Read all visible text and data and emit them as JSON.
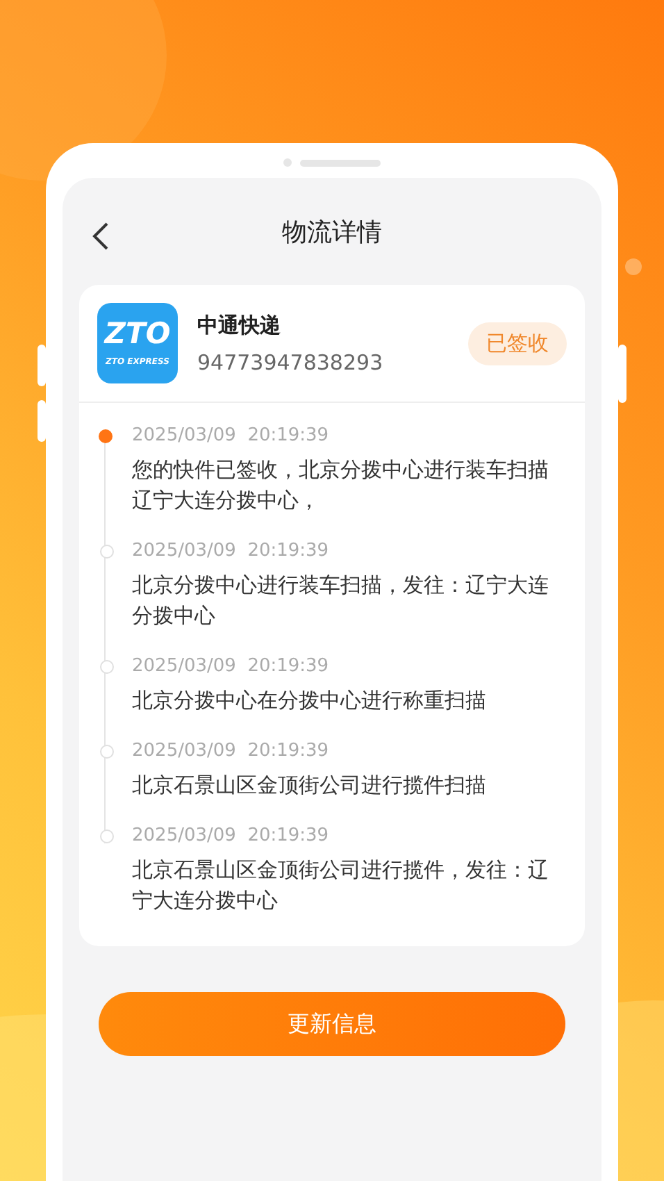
{
  "header": {
    "title": "物流详情"
  },
  "courier": {
    "logo_text": "ZTO",
    "logo_subtext": "ZTO EXPRESS",
    "name": "中通快递",
    "tracking_number": "94773947838293",
    "status": "已签收"
  },
  "timeline": [
    {
      "time": "2025/03/09  20:19:39",
      "text": "您的快件已签收，北京分拨中心进行装车扫描辽宁大连分拨中心，",
      "current": true
    },
    {
      "time": "2025/03/09  20:19:39",
      "text": "北京分拨中心进行装车扫描，发往：辽宁大连分拨中心",
      "current": false
    },
    {
      "time": "2025/03/09  20:19:39",
      "text": "北京分拨中心在分拨中心进行称重扫描",
      "current": false
    },
    {
      "time": "2025/03/09  20:19:39",
      "text": "北京石景山区金顶街公司进行揽件扫描",
      "current": false
    },
    {
      "time": "2025/03/09  20:19:39",
      "text": "北京石景山区金顶街公司进行揽件，发往：辽宁大连分拨中心",
      "current": false
    }
  ],
  "button": {
    "label": "更新信息"
  }
}
